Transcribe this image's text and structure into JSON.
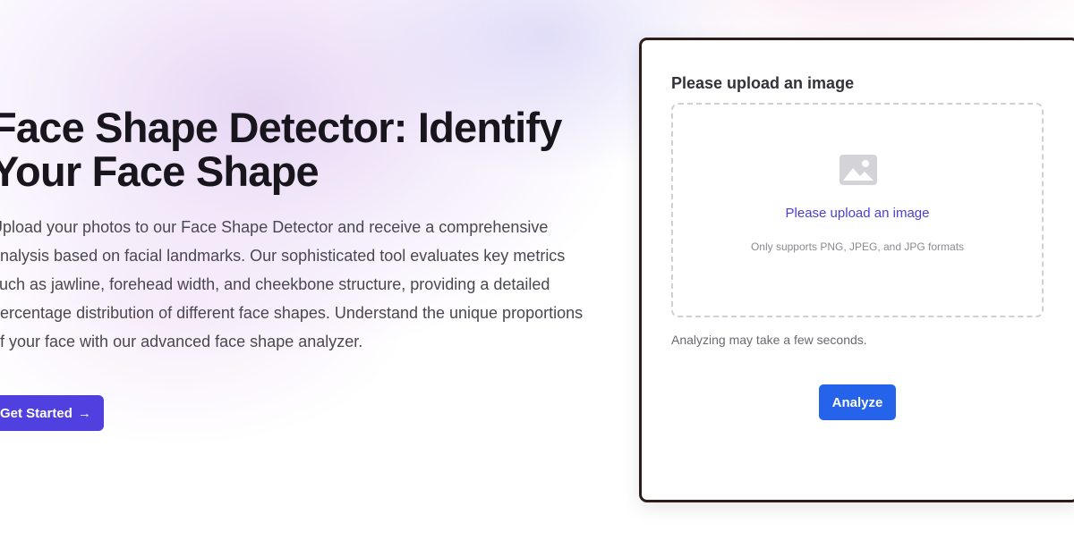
{
  "hero": {
    "title": "Face Shape Detector: Identify Your Face Shape",
    "description": "Upload your photos to our Face Shape Detector and receive a comprehensive analysis based on facial landmarks. Our sophisticated tool evaluates key metrics such as jawline, forehead width, and cheekbone structure, providing a detailed percentage distribution of different face shapes. Understand the unique proportions of your face with our advanced face shape analyzer.",
    "cta_label": "Get Started",
    "cta_arrow": "→"
  },
  "uploader": {
    "label": "Please upload an image",
    "dropzone_title": "Please upload an image",
    "dropzone_hint": "Only supports PNG, JPEG, and JPG formats",
    "dropzone_icon": "image-icon",
    "note": "Analyzing may take a few seconds.",
    "analyze_label": "Analyze"
  },
  "colors": {
    "primary_purple": "#5140e0",
    "analyze_blue": "#2563eb",
    "link_purple": "#4a3fd8",
    "title_dark": "#18161c"
  }
}
